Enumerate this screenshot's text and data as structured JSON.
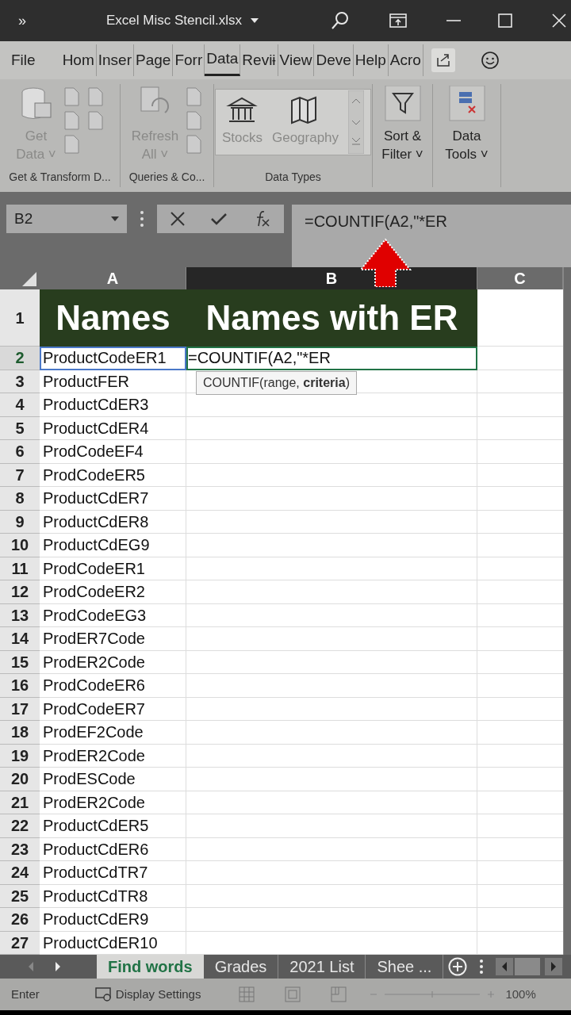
{
  "window": {
    "title": "Excel Misc Stencil.xlsx",
    "overflow_glyph": "»"
  },
  "ribbon_tabs": [
    {
      "label": "File",
      "selected": false
    },
    {
      "label": "Hom",
      "selected": false
    },
    {
      "label": "Inser",
      "selected": false
    },
    {
      "label": "Page",
      "selected": false
    },
    {
      "label": "Forr",
      "selected": false
    },
    {
      "label": "Data",
      "selected": true
    },
    {
      "label": "Reviɨ",
      "selected": false
    },
    {
      "label": "View",
      "selected": false
    },
    {
      "label": "Deve",
      "selected": false
    },
    {
      "label": "Help",
      "selected": false
    },
    {
      "label": "Acro",
      "selected": false
    }
  ],
  "ribbon_groups": [
    {
      "label": "Get & Transform D...",
      "buttons": [
        "Get",
        "Data ˅"
      ]
    },
    {
      "label": "Queries & Co...",
      "buttons": [
        "Refresh",
        "All ˅"
      ]
    },
    {
      "label": "Data Types",
      "buttons": [
        "Stocks",
        "Geography"
      ]
    },
    {
      "buttons": [
        "Sort &",
        "Filter ˅"
      ]
    },
    {
      "buttons": [
        "Data",
        "Tools ˅"
      ]
    }
  ],
  "name_box": "B2",
  "formula": "=COUNTIF(A2,\"*ER",
  "columns": [
    {
      "label": "A",
      "selected": false
    },
    {
      "label": "B",
      "selected": true
    },
    {
      "label": "C",
      "selected": false
    }
  ],
  "header_row": {
    "number": "1",
    "cells": [
      "Names",
      "Names with ER"
    ]
  },
  "rows": [
    {
      "number": "2",
      "a": "ProductCodeER1",
      "b": "=COUNTIF(A2,\"*ER"
    },
    {
      "number": "3",
      "a": "ProductFER"
    },
    {
      "number": "4",
      "a": "ProductCdER3"
    },
    {
      "number": "5",
      "a": "ProductCdER4"
    },
    {
      "number": "6",
      "a": "ProdCodeEF4"
    },
    {
      "number": "7",
      "a": "ProdCodeER5"
    },
    {
      "number": "8",
      "a": "ProductCdER7"
    },
    {
      "number": "9",
      "a": "ProductCdER8"
    },
    {
      "number": "10",
      "a": "ProductCdEG9"
    },
    {
      "number": "11",
      "a": "ProdCodeER1"
    },
    {
      "number": "12",
      "a": "ProdCodeER2"
    },
    {
      "number": "13",
      "a": "ProdCodeEG3"
    },
    {
      "number": "14",
      "a": "ProdER7Code"
    },
    {
      "number": "15",
      "a": "ProdER2Code"
    },
    {
      "number": "16",
      "a": "ProdCodeER6"
    },
    {
      "number": "17",
      "a": "ProdCodeER7"
    },
    {
      "number": "18",
      "a": "ProdEF2Code"
    },
    {
      "number": "19",
      "a": "ProdER2Code"
    },
    {
      "number": "20",
      "a": "ProdESCode"
    },
    {
      "number": "21",
      "a": "ProdER2Code"
    },
    {
      "number": "22",
      "a": "ProductCdER5"
    },
    {
      "number": "23",
      "a": "ProductCdER6"
    },
    {
      "number": "24",
      "a": "ProductCdTR7"
    },
    {
      "number": "25",
      "a": "ProductCdTR8"
    },
    {
      "number": "26",
      "a": "ProductCdER9"
    },
    {
      "number": "27",
      "a": "ProductCdER10"
    }
  ],
  "tooltip": "COUNTIF(range, **criteria**)",
  "sheet_tabs": [
    {
      "label": "Find words",
      "selected": true
    },
    {
      "label": "Grades",
      "selected": false
    },
    {
      "label": "2021 List",
      "selected": false
    },
    {
      "label": "Shee  ...",
      "selected": false
    }
  ],
  "status_bar": {
    "mode": "Enter",
    "display_settings": "Display Settings",
    "zoom": "100%"
  }
}
